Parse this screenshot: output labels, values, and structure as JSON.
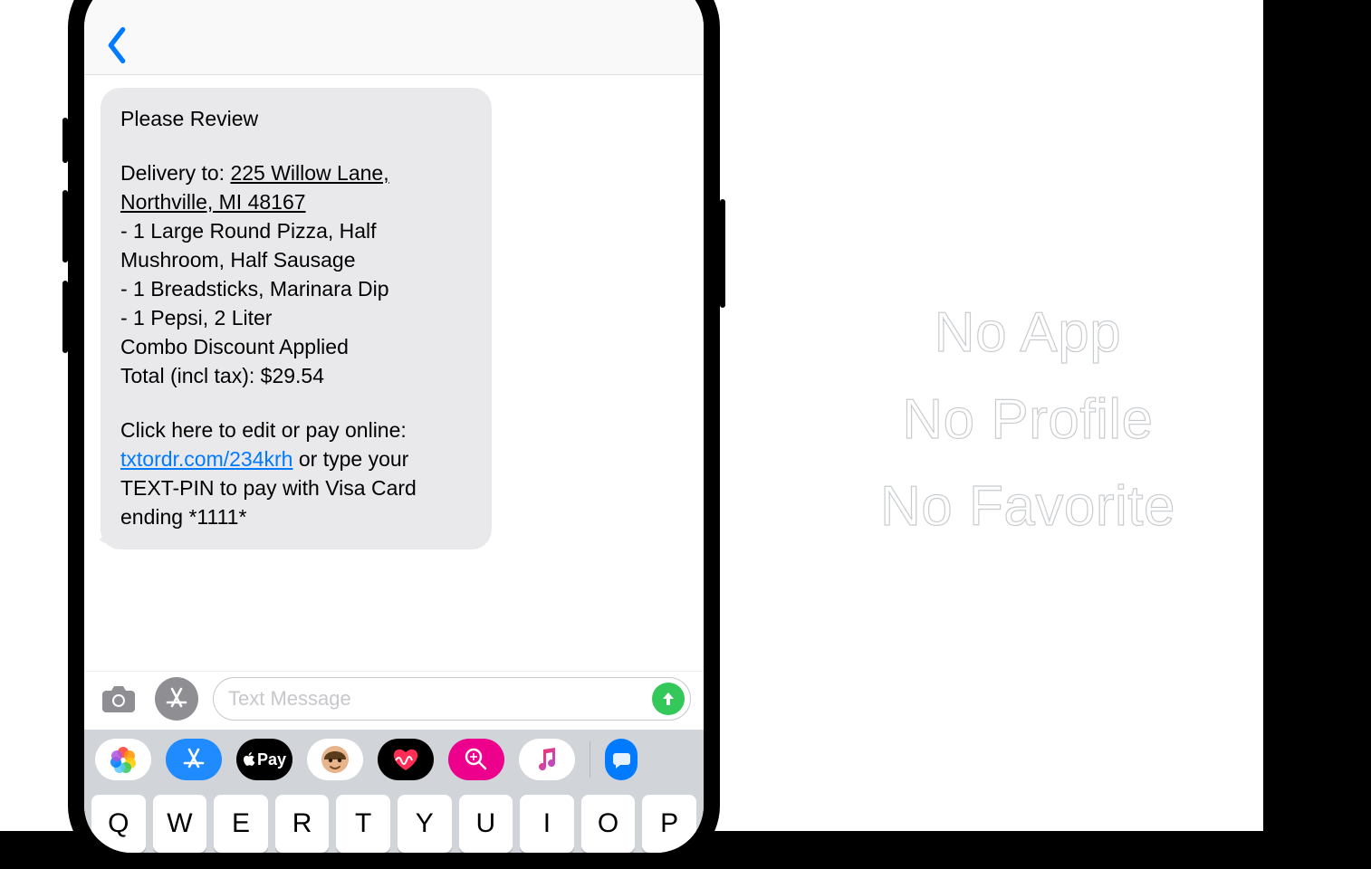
{
  "message": {
    "title": "Please Review",
    "delivery_prefix": "Delivery to: ",
    "address": "225 Willow Lane, Northville, MI 48167",
    "items": [
      "- 1 Large Round Pizza, Half Mushroom, Half Sausage",
      "- 1 Breadsticks, Marinara Dip",
      "- 1 Pepsi, 2 Liter"
    ],
    "discount": "Combo Discount Applied",
    "total": "Total (incl tax): $29.54",
    "cta_prefix": "Click here to edit or pay online: ",
    "link_text": "txtordr.com/234krh",
    "cta_suffix": " or type your TEXT-PIN to pay with Visa Card ending *1111*"
  },
  "compose": {
    "placeholder": "Text Message"
  },
  "app_strip": {
    "apple_pay_label": "Pay"
  },
  "keyboard_row": [
    "Q",
    "W",
    "E",
    "R",
    "T",
    "Y",
    "U",
    "I",
    "O",
    "P"
  ],
  "headlines": [
    "No App",
    "No Profile",
    "No Favorite"
  ]
}
